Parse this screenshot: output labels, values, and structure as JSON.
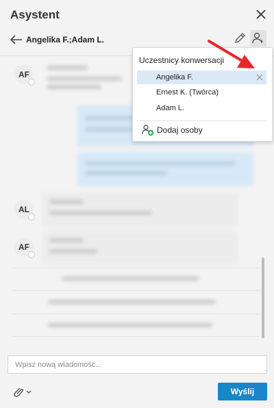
{
  "header": {
    "title": "Asystent"
  },
  "conversation": {
    "participants_title": "Angelika F.;Adam L."
  },
  "avatars": [
    "AF",
    "AL",
    "AF"
  ],
  "participants_dropdown": {
    "title": "Uczestnicy konwersacji",
    "items": [
      {
        "label": "Angelika F.",
        "selected": true
      },
      {
        "label": "Ernest K. (Twórca)",
        "selected": false
      },
      {
        "label": "Adam L.",
        "selected": false
      }
    ],
    "add_label": "Dodaj osoby"
  },
  "composer": {
    "placeholder": "Wpisz nową wiadomość...",
    "send_label": "Wyślij"
  },
  "colors": {
    "accent": "#1a86c8",
    "selected_row": "#dbe9f6",
    "annotation_arrow": "#e8272a"
  },
  "icons": [
    "close-icon",
    "back-arrow-icon",
    "pencil-icon",
    "people-icon",
    "remove-icon",
    "add-person-icon",
    "paperclip-icon",
    "chevron-down-icon"
  ]
}
